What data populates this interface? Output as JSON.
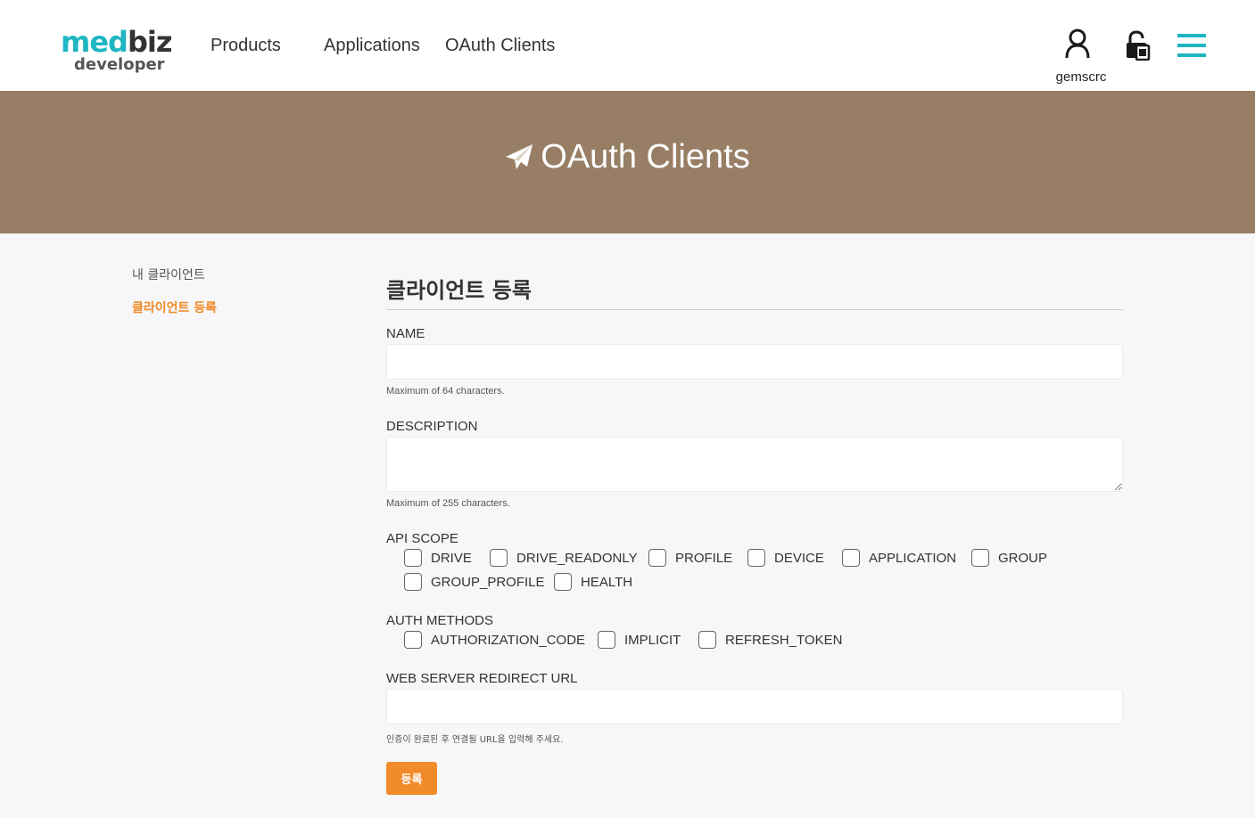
{
  "header": {
    "logo": {
      "top_left": "med",
      "top_right": "biz",
      "bottom": "developer"
    },
    "nav": [
      {
        "label": "Products"
      },
      {
        "label": "Applications"
      },
      {
        "label": "OAuth Clients"
      }
    ],
    "user": {
      "name": "gemscrc",
      "icon": "user-icon"
    },
    "lock_icon": "lock-icon",
    "menu_icon": "hamburger-menu-icon",
    "accent_color": "#1fb5c2"
  },
  "banner": {
    "title": "OAuth Clients",
    "icon": "paper-plane-icon",
    "background_color": "#977e65"
  },
  "sidebar": {
    "items": [
      {
        "label": "내 클라이언트",
        "active": false
      },
      {
        "label": "클라이언트 등록",
        "active": true
      }
    ],
    "active_color": "#f08a24"
  },
  "form": {
    "title": "클라이언트 등록",
    "name": {
      "label": "NAME",
      "value": "",
      "placeholder": "",
      "help": "Maximum of 64 characters."
    },
    "description": {
      "label": "DESCRIPTION",
      "value": "",
      "placeholder": "",
      "help": "Maximum of 255 characters."
    },
    "api_scope": {
      "label": "API SCOPE",
      "options": [
        {
          "label": "DRIVE",
          "checked": false
        },
        {
          "label": "DRIVE_READONLY",
          "checked": false
        },
        {
          "label": "PROFILE",
          "checked": false
        },
        {
          "label": "DEVICE",
          "checked": false
        },
        {
          "label": "APPLICATION",
          "checked": false
        },
        {
          "label": "GROUP",
          "checked": false
        },
        {
          "label": "GROUP_PROFILE",
          "checked": false
        },
        {
          "label": "HEALTH",
          "checked": false
        }
      ]
    },
    "auth_methods": {
      "label": "AUTH METHODS",
      "options": [
        {
          "label": "AUTHORIZATION_CODE",
          "checked": false
        },
        {
          "label": "IMPLICIT",
          "checked": false
        },
        {
          "label": "REFRESH_TOKEN",
          "checked": false
        }
      ]
    },
    "redirect_url": {
      "label": "WEB SERVER REDIRECT URL",
      "value": "",
      "placeholder": "",
      "help": "인증이 완료된 후 연결될 URL을 입력해 주세요."
    },
    "submit_label": "등록",
    "submit_color": "#f28b2a"
  }
}
